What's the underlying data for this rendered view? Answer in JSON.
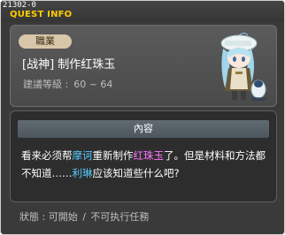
{
  "window": {
    "quest_id": "21302-0",
    "title": "QUEST INFO"
  },
  "info": {
    "job_label": "職業",
    "quest_name": "[战神] 制作红珠玉",
    "level_label": "建議等級 :",
    "level_range": "60 ~ 64"
  },
  "npc": {
    "icon": "npc-portrait-icon"
  },
  "content": {
    "header": "內容",
    "segments": [
      {
        "text": "看来必须帮",
        "color": "#ffffff"
      },
      {
        "text": "摩诃",
        "color": "#55ccff"
      },
      {
        "text": "重新制作",
        "color": "#ffffff"
      },
      {
        "text": "红珠玉",
        "color": "#ff77ff"
      },
      {
        "text": "了。但是材料和方法都不知道……",
        "color": "#ffffff"
      },
      {
        "text": "利琳",
        "color": "#55ccff"
      },
      {
        "text": "应该知道些什么吧?",
        "color": "#ffffff"
      }
    ]
  },
  "status": {
    "label": "狀態 :",
    "value": "可開始",
    "separator": "/",
    "note": "不可执行任務"
  },
  "colors": {
    "title": "#ffcc00",
    "npc_name": "#55ccff",
    "item_name": "#ff77ff"
  }
}
